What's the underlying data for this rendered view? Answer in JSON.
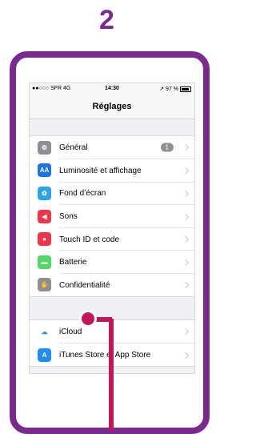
{
  "step_number": "2",
  "statusbar": {
    "carrier": "●●○○○ SFR  4G",
    "time": "14:30",
    "battery": "↗ 97 %"
  },
  "navbar": {
    "title": "Réglages"
  },
  "groups": [
    [
      {
        "label": "Général",
        "icon": "gear-icon",
        "color": "#8e8e93",
        "glyph": "⚙",
        "badge": "1"
      },
      {
        "label": "Luminosité et affichage",
        "icon": "brightness-icon",
        "color": "#1a73e8",
        "glyph": "AA"
      },
      {
        "label": "Fond d’écran",
        "icon": "wallpaper-icon",
        "color": "#2aa6e8",
        "glyph": "✿"
      },
      {
        "label": "Sons",
        "icon": "speaker-icon",
        "color": "#f0344b",
        "glyph": "◀"
      },
      {
        "label": "Touch ID et code",
        "icon": "fingerprint-icon",
        "color": "#f0344b",
        "glyph": "●"
      },
      {
        "label": "Batterie",
        "icon": "battery-icon",
        "color": "#4cd964",
        "glyph": "▬"
      },
      {
        "label": "Confidentialité",
        "icon": "hand-icon",
        "color": "#8e8e93",
        "glyph": "✋"
      }
    ],
    [
      {
        "label": "iCloud",
        "icon": "cloud-icon",
        "color": "#ffffff",
        "glyph": "☁",
        "glyph_color": "#3b8ef0"
      },
      {
        "label": "iTunes Store et App Store",
        "icon": "appstore-icon",
        "color": "#1e8ef5",
        "glyph": "A"
      }
    ]
  ]
}
